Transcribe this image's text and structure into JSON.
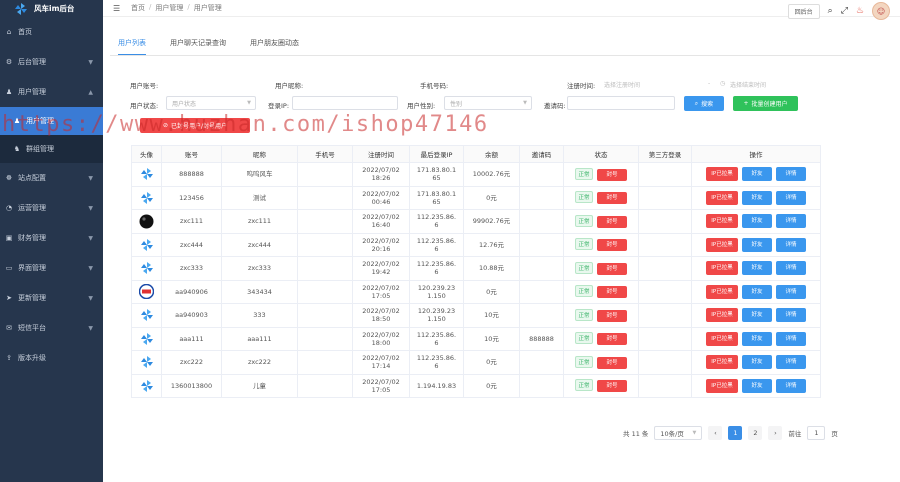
{
  "app": {
    "title": "风车im后台"
  },
  "sidebar": {
    "items": [
      {
        "label": "首页",
        "icon": "home-icon",
        "arrow": false
      },
      {
        "label": "后台管理",
        "icon": "gear-icon",
        "arrow": true
      },
      {
        "label": "用户管理",
        "icon": "user-icon",
        "arrow": true,
        "open": true,
        "children": [
          {
            "label": "用户管理",
            "icon": "user-icon",
            "active": true
          },
          {
            "label": "群组管理",
            "icon": "group-icon",
            "active": false
          }
        ]
      },
      {
        "label": "站点配置",
        "icon": "settings-icon",
        "arrow": true
      },
      {
        "label": "运营管理",
        "icon": "chart-icon",
        "arrow": true
      },
      {
        "label": "财务管理",
        "icon": "wallet-icon",
        "arrow": true
      },
      {
        "label": "界面管理",
        "icon": "monitor-icon",
        "arrow": true
      },
      {
        "label": "更新管理",
        "icon": "send-icon",
        "arrow": true
      },
      {
        "label": "短信平台",
        "icon": "message-icon",
        "arrow": true
      },
      {
        "label": "版本升级",
        "icon": "upgrade-icon",
        "arrow": false
      }
    ]
  },
  "header": {
    "crumbs": [
      "首页",
      "用户管理",
      "用户管理"
    ],
    "btn": "回后台"
  },
  "tabs": [
    "用户列表",
    "用户聊天记录查询",
    "用户朋友圈动态"
  ],
  "filters": {
    "account_label": "用户账号:",
    "nickname_label": "用户昵称:",
    "phone_label": "手机号码:",
    "regtime_label": "注册时间:",
    "regtime_start": "选择注册时间",
    "regtime_end": "选择结束时间",
    "status_label": "用户状态:",
    "status_placeholder": "用户状态",
    "loginip_label": "登录IP:",
    "gender_label": "用户性别:",
    "gender_placeholder": "性别",
    "invite_label": "邀请码:",
    "search_btn": "搜索",
    "create_btn": "批量创建用户",
    "red_btn": "已封号用户/封号用户"
  },
  "table": {
    "headers": [
      "头像",
      "账号",
      "昵称",
      "手机号",
      "注册时间",
      "最后登录IP",
      "余额",
      "邀请码",
      "状态",
      "第三方登录",
      "操作"
    ],
    "rows": [
      {
        "avatar": "pinwheel",
        "account": "888888",
        "nick": "呜呜风车",
        "phone": "",
        "reg": "2022/07/02 18:26",
        "ip": "171.83.80.1\n65",
        "bal": "10002.76元",
        "inv": "",
        "ops": [
          "IP已拉黑",
          "好友",
          "详情"
        ]
      },
      {
        "avatar": "pinwheel",
        "account": "123456",
        "nick": "测试",
        "phone": "",
        "reg": "2022/07/02 00:46",
        "ip": "171.83.80.1\n65",
        "bal": "0元",
        "inv": "",
        "ops": [
          "IP已拉黑",
          "好友",
          "详情"
        ]
      },
      {
        "avatar": "ball",
        "account": "zxc111",
        "nick": "zxc111",
        "phone": "",
        "reg": "2022/07/02 16:40",
        "ip": "112.235.86.\n6",
        "bal": "99902.76元",
        "inv": "",
        "ops": [
          "IP已拉黑",
          "好友",
          "详情"
        ]
      },
      {
        "avatar": "pinwheel",
        "account": "zxc444",
        "nick": "zxc444",
        "phone": "",
        "reg": "2022/07/02 20:16",
        "ip": "112.235.86.\n6",
        "bal": "12.76元",
        "inv": "",
        "ops": [
          "IP已拉黑",
          "好友",
          "详情"
        ]
      },
      {
        "avatar": "pinwheel",
        "account": "zxc333",
        "nick": "zxc333",
        "phone": "",
        "reg": "2022/07/02 19:42",
        "ip": "112.235.86.\n6",
        "bal": "10.88元",
        "inv": "",
        "ops": [
          "IP已拉黑",
          "好友",
          "详情"
        ]
      },
      {
        "avatar": "badge",
        "account": "aa940906",
        "nick": "343434",
        "phone": "",
        "reg": "2022/07/02 17:05",
        "ip": "120.239.23\n1.150",
        "bal": "0元",
        "inv": "",
        "ops": [
          "IP已拉黑",
          "好友",
          "详情"
        ]
      },
      {
        "avatar": "pinwheel",
        "account": "aa940903",
        "nick": "333",
        "phone": "",
        "reg": "2022/07/02 18:50",
        "ip": "120.239.23\n1.150",
        "bal": "10元",
        "inv": "",
        "ops": [
          "IP已拉黑",
          "好友",
          "详情"
        ]
      },
      {
        "avatar": "pinwheel",
        "account": "aaa111",
        "nick": "aaa111",
        "phone": "",
        "reg": "2022/07/02 18:00",
        "ip": "112.235.86.\n6",
        "bal": "10元",
        "inv": "888888",
        "ops": [
          "IP已拉黑",
          "好友",
          "详情"
        ]
      },
      {
        "avatar": "pinwheel",
        "account": "zxc222",
        "nick": "zxc222",
        "phone": "",
        "reg": "2022/07/02 17:14",
        "ip": "112.235.86.\n6",
        "bal": "0元",
        "inv": "",
        "ops": [
          "IP已拉黑",
          "好友",
          "详情"
        ]
      },
      {
        "avatar": "pinwheel",
        "account": "1360013800",
        "nick": "儿童",
        "phone": "",
        "reg": "2022/07/02 17:05",
        "ip": "1.194.19.83",
        "bal": "0元",
        "inv": "",
        "ops": [
          "IP已拉黑",
          "好友",
          "详情"
        ]
      }
    ],
    "status_ok": "正常",
    "status_ban": "封号"
  },
  "pager": {
    "total": "共 11 条",
    "size": "10条/页",
    "pages": [
      "1",
      "2"
    ],
    "current": "1",
    "goto": "前往",
    "goto_val": "1",
    "unit": "页"
  },
  "watermark": "https://www.huzhan.com/ishop47146",
  "colors": {
    "sidebar": "#26364d",
    "primary": "#3a8ee6",
    "danger": "#f04848",
    "success": "#2fc25b"
  }
}
